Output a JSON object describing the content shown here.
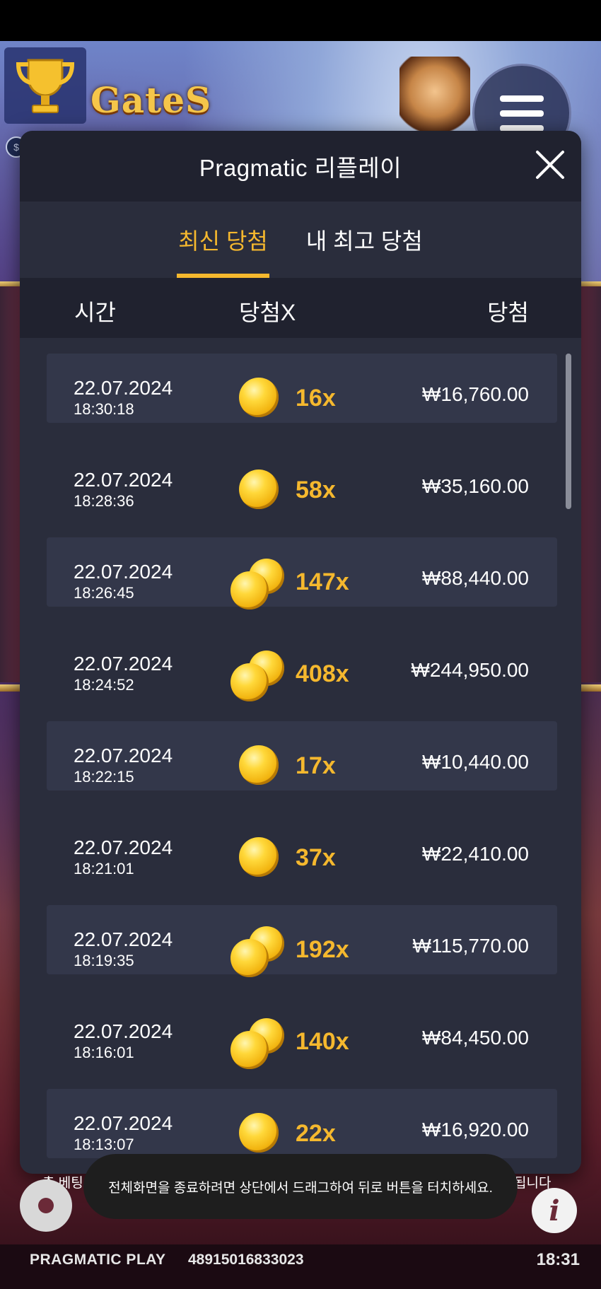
{
  "game": {
    "logo_text": "GateS",
    "bottom_left_text": "총 베팅",
    "bottom_right_text": "됩니다",
    "brand": "PRAGMATIC PLAY",
    "game_id": "48915016833023",
    "clock": "18:31"
  },
  "modal": {
    "title": "Pragmatic 리플레이",
    "tabs": [
      {
        "label": "최신 당첨",
        "active": true
      },
      {
        "label": "내 최고 당첨",
        "active": false
      }
    ],
    "columns": {
      "time": "시간",
      "multiplier": "당첨X",
      "win": "당첨"
    },
    "rows": [
      {
        "date": "22.07.2024",
        "time": "18:30:18",
        "multiplier": "16x",
        "amount": "₩16,760.00",
        "coins": 1
      },
      {
        "date": "22.07.2024",
        "time": "18:28:36",
        "multiplier": "58x",
        "amount": "₩35,160.00",
        "coins": 1
      },
      {
        "date": "22.07.2024",
        "time": "18:26:45",
        "multiplier": "147x",
        "amount": "₩88,440.00",
        "coins": 2
      },
      {
        "date": "22.07.2024",
        "time": "18:24:52",
        "multiplier": "408x",
        "amount": "₩244,950.00",
        "coins": 2
      },
      {
        "date": "22.07.2024",
        "time": "18:22:15",
        "multiplier": "17x",
        "amount": "₩10,440.00",
        "coins": 1
      },
      {
        "date": "22.07.2024",
        "time": "18:21:01",
        "multiplier": "37x",
        "amount": "₩22,410.00",
        "coins": 1
      },
      {
        "date": "22.07.2024",
        "time": "18:19:35",
        "multiplier": "192x",
        "amount": "₩115,770.00",
        "coins": 2
      },
      {
        "date": "22.07.2024",
        "time": "18:16:01",
        "multiplier": "140x",
        "amount": "₩84,450.00",
        "coins": 2
      },
      {
        "date": "22.07.2024",
        "time": "18:13:07",
        "multiplier": "22x",
        "amount": "₩16,920.00",
        "coins": 1
      }
    ]
  },
  "toast": {
    "message": "전체화면을 종료하려면 상단에서 드래그하여 뒤로 버튼을 터치하세요."
  },
  "colors": {
    "accent": "#f5b82e",
    "modal_bg": "#2a2d3c",
    "header_bg": "#20222f",
    "row_alt_bg": "#33374a"
  },
  "icons": {
    "trophy": "trophy-icon",
    "menu": "hamburger-menu-icon",
    "close": "close-icon",
    "coin": "gold-coin-icon",
    "settings": "gear-icon",
    "info": "info-icon"
  }
}
